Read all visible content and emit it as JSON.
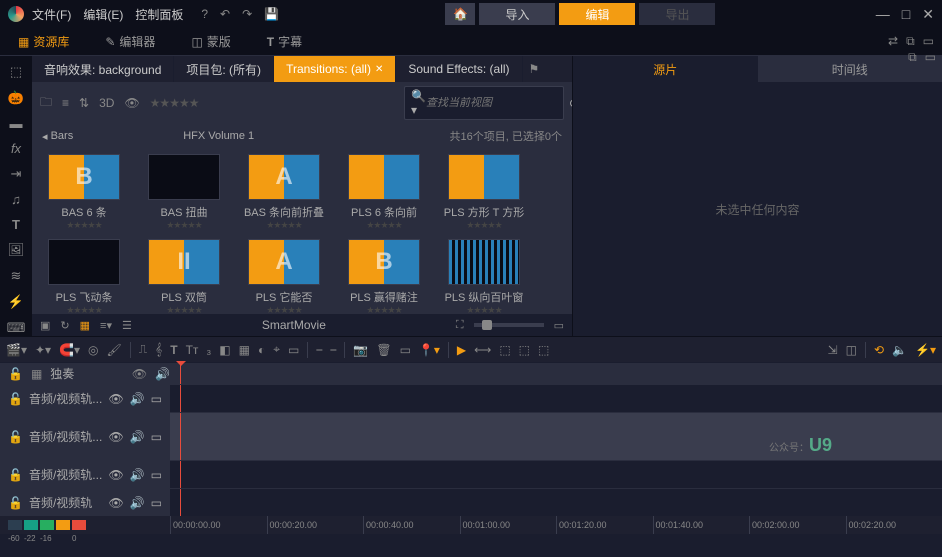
{
  "menu": {
    "file": "文件(F)",
    "edit": "编辑(E)",
    "control": "控制面板"
  },
  "topbar": {
    "import": "导入",
    "edit": "编辑",
    "export": "导出"
  },
  "main_tabs": {
    "library": "资源库",
    "editor": "编辑器",
    "mask": "蒙版",
    "subtitle": "字幕"
  },
  "filters": {
    "sound_effect": "音响效果: background",
    "project": "项目包: (所有)",
    "transitions": "Transitions: (all)",
    "sfx": "Sound Effects: (all)"
  },
  "browser_toolbar": {
    "threed": "3D"
  },
  "search": {
    "placeholder": "查找当前视图"
  },
  "breadcrumb": {
    "bars": "Bars",
    "volume": "HFX Volume 1",
    "info": "共16个项目, 已选择0个"
  },
  "thumbs": [
    {
      "label": "BAS 6 条",
      "variant": "orange-blue",
      "letter": "B"
    },
    {
      "label": "BAS 扭曲",
      "variant": "dark"
    },
    {
      "label": "BAS 条向前折叠",
      "variant": "orange-blue",
      "letter": "A"
    },
    {
      "label": "PLS 6 条向前",
      "variant": "orange-blue"
    },
    {
      "label": "PLS 方形 T 方形",
      "variant": "orange-blue"
    },
    {
      "label": "PLS 飞动条",
      "variant": "dark"
    },
    {
      "label": "PLS 双筒",
      "variant": "orange-blue",
      "letter": "II"
    },
    {
      "label": "PLS 它能否",
      "variant": "orange-blue",
      "letter": "A"
    },
    {
      "label": "PLS 赢得赌注",
      "variant": "orange-blue",
      "letter": "B"
    },
    {
      "label": "PLS 纵向百叶窗",
      "variant": "lines"
    }
  ],
  "browser_footer": {
    "smartmovie": "SmartMovie"
  },
  "preview": {
    "source": "源片",
    "timeline": "时间线",
    "empty": "未选中任何内容"
  },
  "track_header": {
    "solo": "独奏"
  },
  "tracks": [
    {
      "label": "音频/视频轨..."
    },
    {
      "label": "音频/视频轨..."
    },
    {
      "label": "音频/视频轨..."
    },
    {
      "label": "音频/视频轨"
    }
  ],
  "meter": [
    {
      "v": "-60",
      "c": "#2c3e50"
    },
    {
      "v": "-22",
      "c": "#16a085"
    },
    {
      "v": "-16",
      "c": "#27ae60"
    },
    {
      "v": "",
      "c": "#f39c12"
    },
    {
      "v": "0",
      "c": "#e74c3c"
    }
  ],
  "ticks": [
    "00:00:00.00",
    "00:00:20.00",
    "00:00:40.00",
    "00:01:00.00",
    "00:01:20.00",
    "00:01:40.00",
    "00:02:00.00",
    "00:02:20.00"
  ],
  "watermark": {
    "prefix": "公众号：",
    "logo": "U9"
  }
}
